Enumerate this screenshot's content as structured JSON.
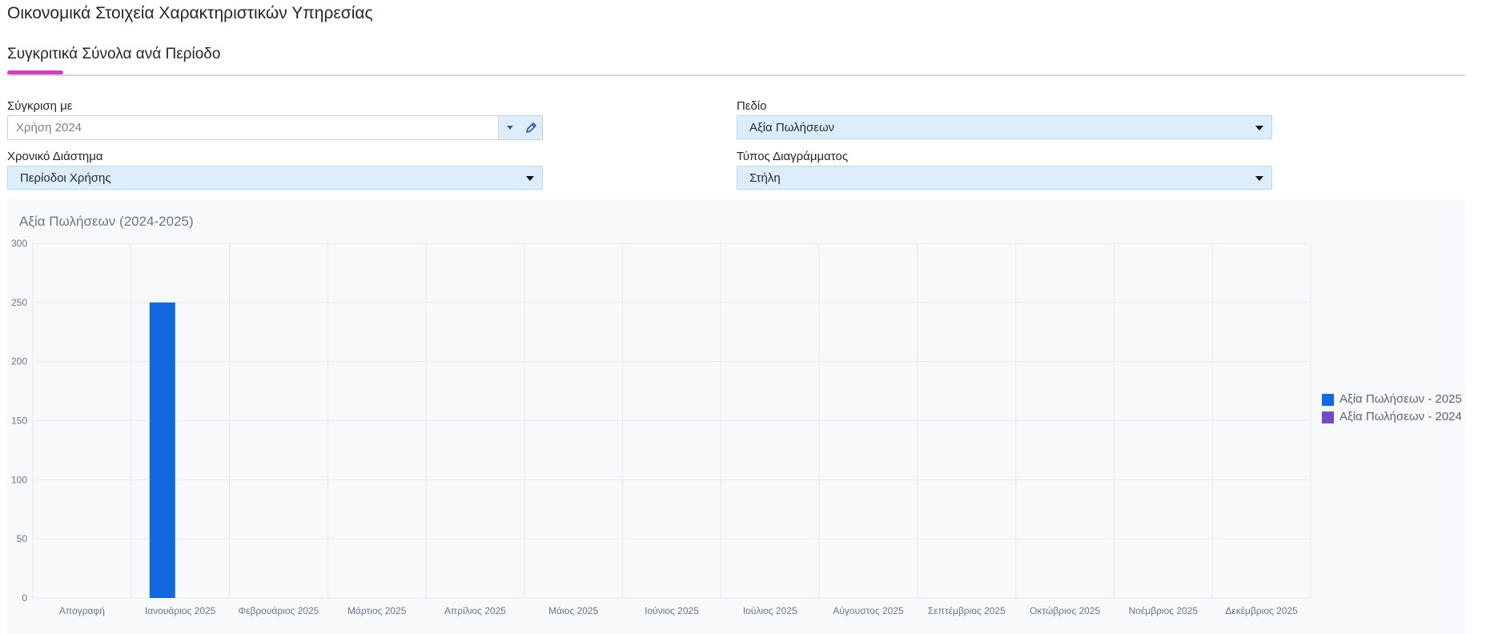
{
  "page": {
    "title": "Οικονομικά Στοιχεία Χαρακτηριστικών Υπηρεσίας"
  },
  "tabs": [
    {
      "label": "Συγκριτικά Σύνολα ανά Περίοδο",
      "active": true
    }
  ],
  "colors": {
    "tab_indicator": "#d63ec2",
    "select_bg": "#ddedfb",
    "series_2025": "#1168e0",
    "series_2024": "#6f4bc9"
  },
  "filters": {
    "compare": {
      "label": "Σύγκριση με",
      "value": "Χρήση 2024",
      "dropdown_icon": "caret-down-icon",
      "edit_icon": "pencil-icon"
    },
    "field": {
      "label": "Πεδίο",
      "value": "Αξία Πωλήσεων"
    },
    "period": {
      "label": "Χρονικό Διάστημα",
      "value": "Περίοδοι Χρήσης"
    },
    "chart_type": {
      "label": "Τύπος Διαγράμματος",
      "value": "Στήλη"
    }
  },
  "chart_data": {
    "type": "bar",
    "title": "Αξία Πωλήσεων (2024-2025)",
    "xlabel": "",
    "ylabel": "",
    "ylim": [
      0,
      300
    ],
    "yticks": [
      0,
      50,
      100,
      150,
      200,
      250,
      300
    ],
    "grid": true,
    "legend_position": "right",
    "categories": [
      "Απογραφή",
      "Ιανουάριος 2025",
      "Φεβρουάριος 2025",
      "Μάρτιος 2025",
      "Απρίλιος 2025",
      "Μάιος 2025",
      "Ιούνιος 2025",
      "Ιούλιος 2025",
      "Αύγουστος 2025",
      "Σεπτέμβριος 2025",
      "Οκτώβριος 2025",
      "Νοέμβριος 2025",
      "Δεκέμβριος 2025"
    ],
    "series": [
      {
        "name": "Αξία Πωλήσεων - 2025",
        "color": "#1168e0",
        "values": [
          0,
          250,
          0,
          0,
          0,
          0,
          0,
          0,
          0,
          0,
          0,
          0,
          0
        ]
      },
      {
        "name": "Αξία Πωλήσεων - 2024",
        "color": "#6f4bc9",
        "values": [
          0,
          0,
          0,
          0,
          0,
          0,
          0,
          0,
          0,
          0,
          0,
          0,
          0
        ]
      }
    ]
  }
}
